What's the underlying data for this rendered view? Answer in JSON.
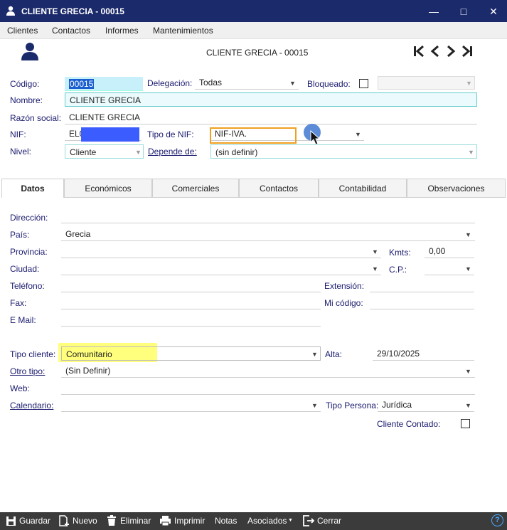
{
  "window": {
    "title": "CLIENTE GRECIA - 00015"
  },
  "menu": [
    "Clientes",
    "Contactos",
    "Informes",
    "Mantenimientos"
  ],
  "header": {
    "title": "CLIENTE GRECIA - 00015"
  },
  "form": {
    "codigo_label": "Código:",
    "codigo_value": "00015",
    "delegacion_label": "Delegación:",
    "delegacion_value": "Todas",
    "bloqueado_label": "Bloqueado:",
    "nombre_label": "Nombre:",
    "nombre_value": "CLIENTE GRECIA",
    "razon_label": "Razón social:",
    "razon_value": "CLIENTE GRECIA",
    "nif_label": "NIF:",
    "nif_value": "EL0",
    "tipo_nif_label": "Tipo de NIF:",
    "tipo_nif_value": "NIF-IVA.",
    "nivel_label": "Nivel:",
    "nivel_value": "Cliente",
    "depende_label": "Depende de:",
    "depende_value": "(sin definir)"
  },
  "tabs": [
    "Datos",
    "Económicos",
    "Comerciales",
    "Contactos",
    "Contabilidad",
    "Observaciones"
  ],
  "datos": {
    "direccion_label": "Dirección:",
    "pais_label": "País:",
    "pais_value": "Grecia",
    "provincia_label": "Provincia:",
    "kmts_label": "Kmts:",
    "kmts_value": "0,00",
    "ciudad_label": "Ciudad:",
    "cp_label": "C.P.:",
    "telefono_label": "Teléfono:",
    "extension_label": "Extensión:",
    "fax_label": "Fax:",
    "micodigo_label": "Mi código:",
    "email_label": "E Mail:",
    "tipo_cliente_label": "Tipo cliente:",
    "tipo_cliente_value": "Comunitario",
    "alta_label": "Alta:",
    "alta_value": "29/10/2025",
    "otro_tipo_label": "Otro tipo:",
    "otro_tipo_value": "(Sin Definir)",
    "web_label": "Web:",
    "calendario_label": "Calendario:",
    "tipo_persona_label": "Tipo Persona:",
    "tipo_persona_value": "Jurídica",
    "cliente_contado_label": "Cliente Contado:"
  },
  "footer": {
    "guardar": "Guardar",
    "nuevo": "Nuevo",
    "eliminar": "Eliminar",
    "imprimir": "Imprimir",
    "notas": "Notas",
    "asociados": "Asociados",
    "cerrar": "Cerrar",
    "help": "?"
  },
  "colors": {
    "titlebar": "#1b2a6b",
    "highlight_yellow": "#ffff66",
    "highlight_orange": "#f0a020",
    "selection_cyan": "#c8f0fa",
    "redact_blue": "#3b5cff",
    "cursor_dot": "#4a7fd4"
  }
}
